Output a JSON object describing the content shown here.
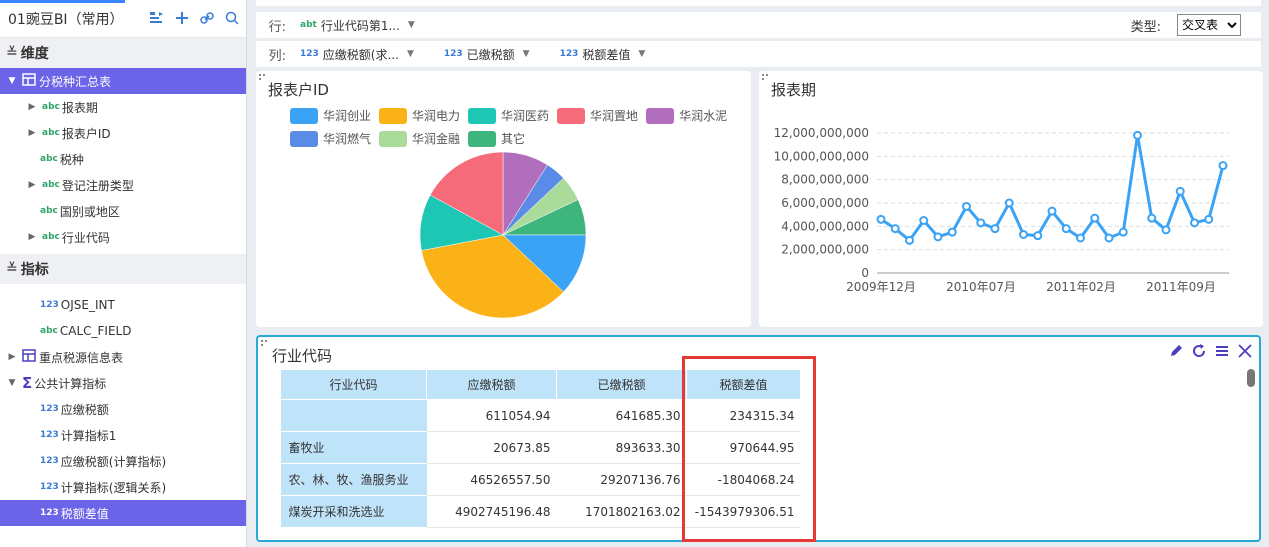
{
  "sidebar": {
    "title": "01豌豆BI（常用）",
    "sections": {
      "dimensions": "维度",
      "metrics": "指标"
    },
    "dim_items": [
      {
        "label": "分税种汇总表",
        "tag": "table",
        "arrow": "▼",
        "selected": true
      },
      {
        "label": "报表期",
        "tag": "abc",
        "arrow": "▶"
      },
      {
        "label": "报表户ID",
        "tag": "abc",
        "arrow": "▶"
      },
      {
        "label": "税种",
        "tag": "abc",
        "arrow": ""
      },
      {
        "label": "登记注册类型",
        "tag": "abc",
        "arrow": "▶"
      },
      {
        "label": "国别或地区",
        "tag": "abc",
        "arrow": ""
      },
      {
        "label": "行业代码",
        "tag": "abc",
        "arrow": "▶"
      }
    ],
    "metric_items": [
      {
        "label": "OJSE_INT",
        "tag": "123",
        "arrow": ""
      },
      {
        "label": "CALC_FIELD",
        "tag": "abc",
        "arrow": ""
      },
      {
        "label": "重点税源信息表",
        "tag": "table",
        "arrow": "▶"
      },
      {
        "label": "公共计算指标",
        "tag": "sigma",
        "arrow": "▼"
      },
      {
        "label": "应缴税额",
        "tag": "123",
        "arrow": ""
      },
      {
        "label": "计算指标1",
        "tag": "123",
        "arrow": ""
      },
      {
        "label": "应缴税额(计算指标)",
        "tag": "123",
        "arrow": ""
      },
      {
        "label": "计算指标(逻辑关系)",
        "tag": "123",
        "arrow": ""
      },
      {
        "label": "税额差值",
        "tag": "123",
        "arrow": "",
        "selected": true
      }
    ]
  },
  "shelves": {
    "row_label": "行:",
    "row_pills": [
      {
        "tag": "abt",
        "text": "行业代码第1..."
      }
    ],
    "col_label": "列:",
    "col_pills": [
      {
        "tag": "123",
        "text": "应缴税额(求..."
      },
      {
        "tag": "123",
        "text": "已缴税额"
      },
      {
        "tag": "123",
        "text": "税额差值"
      }
    ],
    "type_label": "类型:",
    "type_value": "交叉表"
  },
  "pie_panel": {
    "title": "报表户ID"
  },
  "line_panel": {
    "title": "报表期"
  },
  "table_panel": {
    "title": "行业代码",
    "headers": [
      "行业代码",
      "应缴税额",
      "已缴税额",
      "税额差值"
    ],
    "rows": [
      [
        "",
        "611054.94",
        "641685.30",
        "234315.34"
      ],
      [
        "畜牧业",
        "20673.85",
        "893633.30",
        "970644.95"
      ],
      [
        "农、林、牧、渔服务业",
        "46526557.50",
        "29207136.76",
        "-1804068.24"
      ],
      [
        "煤炭开采和洗选业",
        "4902745196.48",
        "1701802163.02",
        "-1543979306.51"
      ]
    ]
  },
  "chart_data": [
    {
      "type": "pie",
      "title": "报表户ID",
      "legend": [
        "华润创业",
        "华润电力",
        "华润医药",
        "华润置地",
        "华润水泥",
        "华润燃气",
        "华润金融",
        "其它"
      ],
      "colors": [
        "#3aa3f5",
        "#fbb217",
        "#1ec6b4",
        "#f56b7a",
        "#b16ebd",
        "#5a8be6",
        "#abdb9b",
        "#3fb57e"
      ],
      "values": [
        12,
        35,
        11,
        17,
        9,
        4,
        5,
        7
      ],
      "slice_order": [
        "华润创业",
        "华润电力",
        "华润医药",
        "华润置地",
        "华润水泥",
        "华润燃气",
        "华润金融",
        "其它"
      ]
    },
    {
      "type": "line",
      "title": "报表期",
      "color": "#3aa3f5",
      "x_ticks": [
        "2009年12月",
        "2010年07月",
        "2011年02月",
        "2011年09月"
      ],
      "y_ticks": [
        "0",
        "2,000,000,000",
        "4,000,000,000",
        "6,000,000,000",
        "8,000,000,000",
        "10,000,000,000",
        "12,000,000,000"
      ],
      "ylim": [
        0,
        12000000000
      ],
      "values": [
        4600000000,
        3800000000,
        2800000000,
        4500000000,
        3100000000,
        3500000000,
        5700000000,
        4300000000,
        3800000000,
        6000000000,
        3300000000,
        3200000000,
        5300000000,
        3800000000,
        3000000000,
        4700000000,
        3000000000,
        3500000000,
        11800000000,
        4700000000,
        3700000000,
        7000000000,
        4300000000,
        4600000000,
        9200000000
      ]
    }
  ]
}
